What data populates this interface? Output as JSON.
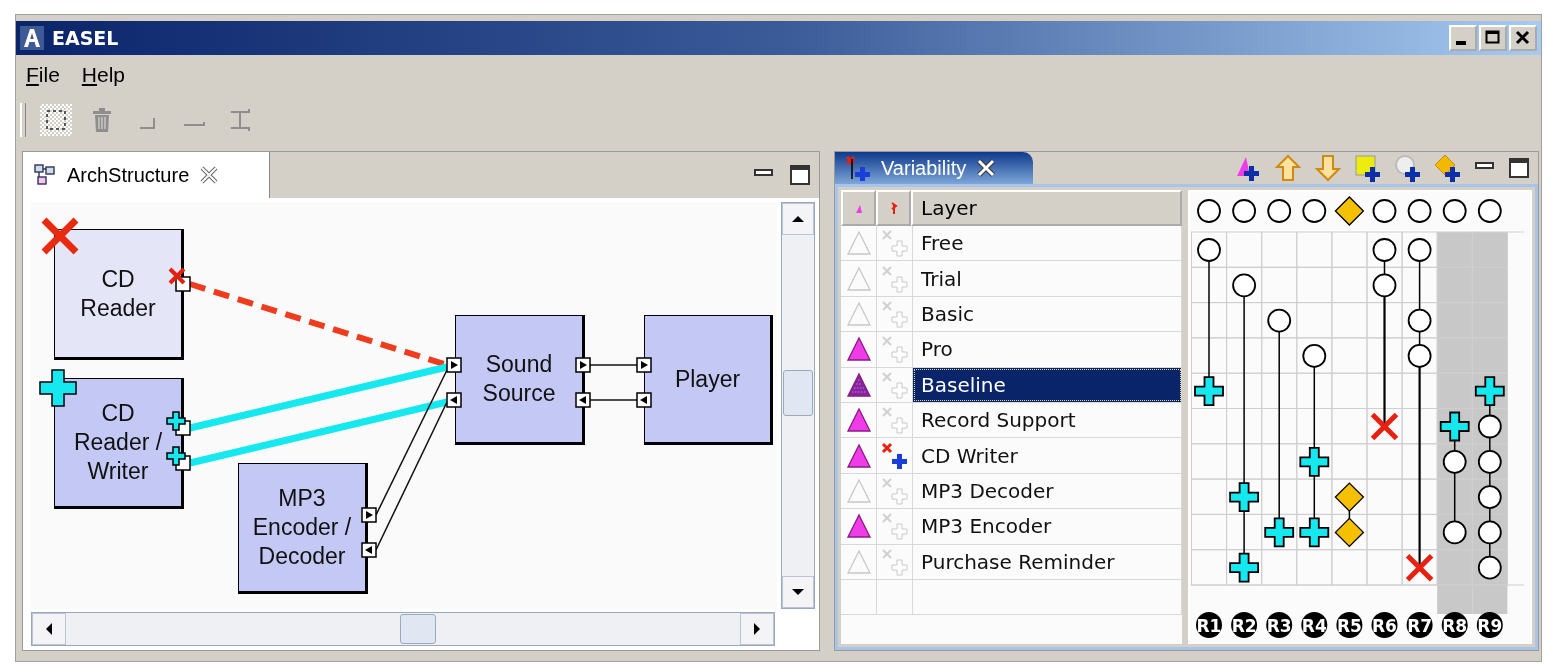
{
  "window": {
    "title": "EASEL"
  },
  "menu": [
    {
      "label": "File"
    },
    {
      "label": "Help"
    }
  ],
  "toolbar": [
    {
      "kind": "select",
      "selected": true,
      "disabled": false
    },
    {
      "kind": "delete",
      "selected": false,
      "disabled": true
    },
    {
      "kind": "corner",
      "selected": false,
      "disabled": true
    },
    {
      "kind": "line",
      "selected": false,
      "disabled": true
    },
    {
      "kind": "bracket",
      "selected": false,
      "disabled": true
    }
  ],
  "arch_panel": {
    "tab": "ArchStructure",
    "nodes": [
      {
        "label": "CD Reader",
        "kind": "removed"
      },
      {
        "label": "CD Reader / Writer",
        "kind": "added"
      },
      {
        "label": "MP3 Encoder / Decoder",
        "kind": "plain"
      },
      {
        "label": "Sound Source",
        "kind": "plain"
      },
      {
        "label": "Player",
        "kind": "plain"
      }
    ],
    "links": [
      {
        "kind": "removed"
      },
      {
        "kind": "added"
      },
      {
        "kind": "added"
      },
      {
        "kind": "normal"
      },
      {
        "kind": "normal"
      },
      {
        "kind": "normal"
      },
      {
        "kind": "normal"
      }
    ]
  },
  "variability_panel": {
    "tab": "Variability",
    "columns": [
      {
        "kind": "included"
      },
      {
        "kind": "changed"
      },
      {
        "kind": "name",
        "label": "Layer"
      }
    ],
    "layers": [
      {
        "name": "Free",
        "included": false,
        "changed": false,
        "selected": false
      },
      {
        "name": "Trial",
        "included": false,
        "changed": false,
        "selected": false
      },
      {
        "name": "Basic",
        "included": false,
        "changed": false,
        "selected": false
      },
      {
        "name": "Pro",
        "included": true,
        "changed": false,
        "selected": false
      },
      {
        "name": "Baseline",
        "included": true,
        "changed": false,
        "selected": true
      },
      {
        "name": "Record Support",
        "included": true,
        "changed": false,
        "selected": false
      },
      {
        "name": "CD Writer",
        "included": true,
        "changed": true,
        "selected": false
      },
      {
        "name": "MP3 Decoder",
        "included": false,
        "changed": false,
        "selected": false
      },
      {
        "name": "MP3 Encoder",
        "included": true,
        "changed": false,
        "selected": false
      },
      {
        "name": "Purchase Reminder",
        "included": false,
        "changed": false,
        "selected": false
      }
    ],
    "relationships": [
      {
        "label": "R1",
        "header": {
          "kind": "circle"
        },
        "shaded": false,
        "cells": [
          {
            "kind": "circle"
          },
          {
            "kind": "none"
          },
          {
            "kind": "none"
          },
          {
            "kind": "none"
          },
          {
            "kind": "plus"
          },
          {
            "kind": "none"
          },
          {
            "kind": "none"
          },
          {
            "kind": "none"
          },
          {
            "kind": "none"
          },
          {
            "kind": "none"
          }
        ]
      },
      {
        "label": "R2",
        "header": {
          "kind": "circle"
        },
        "shaded": false,
        "cells": [
          {
            "kind": "none"
          },
          {
            "kind": "circle"
          },
          {
            "kind": "none"
          },
          {
            "kind": "none"
          },
          {
            "kind": "none"
          },
          {
            "kind": "none"
          },
          {
            "kind": "none"
          },
          {
            "kind": "plus"
          },
          {
            "kind": "none"
          },
          {
            "kind": "plus"
          }
        ]
      },
      {
        "label": "R3",
        "header": {
          "kind": "circle"
        },
        "shaded": false,
        "cells": [
          {
            "kind": "none"
          },
          {
            "kind": "none"
          },
          {
            "kind": "circle"
          },
          {
            "kind": "none"
          },
          {
            "kind": "none"
          },
          {
            "kind": "none"
          },
          {
            "kind": "none"
          },
          {
            "kind": "none"
          },
          {
            "kind": "plus"
          },
          {
            "kind": "none"
          }
        ]
      },
      {
        "label": "R4",
        "header": {
          "kind": "circle"
        },
        "shaded": false,
        "cells": [
          {
            "kind": "none"
          },
          {
            "kind": "none"
          },
          {
            "kind": "none"
          },
          {
            "kind": "circle"
          },
          {
            "kind": "none"
          },
          {
            "kind": "none"
          },
          {
            "kind": "plus"
          },
          {
            "kind": "none"
          },
          {
            "kind": "plus"
          },
          {
            "kind": "none"
          }
        ]
      },
      {
        "label": "R5",
        "header": {
          "kind": "diamond"
        },
        "shaded": false,
        "cells": [
          {
            "kind": "none"
          },
          {
            "kind": "none"
          },
          {
            "kind": "none"
          },
          {
            "kind": "none"
          },
          {
            "kind": "none"
          },
          {
            "kind": "none"
          },
          {
            "kind": "none"
          },
          {
            "kind": "diamond"
          },
          {
            "kind": "diamond"
          },
          {
            "kind": "none"
          }
        ]
      },
      {
        "label": "R6",
        "header": {
          "kind": "circle"
        },
        "shaded": false,
        "cells": [
          {
            "kind": "circle"
          },
          {
            "kind": "circle"
          },
          {
            "kind": "none"
          },
          {
            "kind": "none"
          },
          {
            "kind": "none"
          },
          {
            "kind": "cross"
          },
          {
            "kind": "none"
          },
          {
            "kind": "none"
          },
          {
            "kind": "none"
          },
          {
            "kind": "none"
          }
        ]
      },
      {
        "label": "R7",
        "header": {
          "kind": "circle"
        },
        "shaded": false,
        "cells": [
          {
            "kind": "circle"
          },
          {
            "kind": "none"
          },
          {
            "kind": "circle"
          },
          {
            "kind": "circle"
          },
          {
            "kind": "none"
          },
          {
            "kind": "none"
          },
          {
            "kind": "none"
          },
          {
            "kind": "none"
          },
          {
            "kind": "none"
          },
          {
            "kind": "cross"
          }
        ]
      },
      {
        "label": "R8",
        "header": {
          "kind": "circle"
        },
        "shaded": true,
        "cells": [
          {
            "kind": "none"
          },
          {
            "kind": "none"
          },
          {
            "kind": "none"
          },
          {
            "kind": "none"
          },
          {
            "kind": "none"
          },
          {
            "kind": "plus"
          },
          {
            "kind": "circle"
          },
          {
            "kind": "none"
          },
          {
            "kind": "circle"
          },
          {
            "kind": "none"
          }
        ]
      },
      {
        "label": "R9",
        "header": {
          "kind": "circle"
        },
        "shaded": true,
        "cells": [
          {
            "kind": "none"
          },
          {
            "kind": "none"
          },
          {
            "kind": "none"
          },
          {
            "kind": "none"
          },
          {
            "kind": "plus"
          },
          {
            "kind": "circle"
          },
          {
            "kind": "circle"
          },
          {
            "kind": "circle"
          },
          {
            "kind": "circle"
          },
          {
            "kind": "circle"
          }
        ]
      }
    ]
  }
}
